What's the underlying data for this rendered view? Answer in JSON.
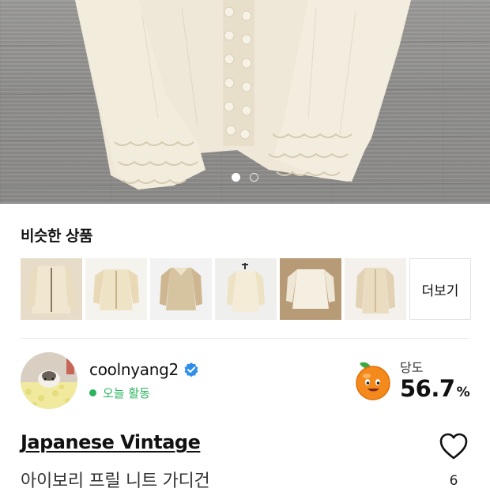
{
  "hero": {
    "slide_count": 2,
    "active_slide": 1
  },
  "similar": {
    "title": "비슷한 상품",
    "more_label": "더보기",
    "items": [
      {
        "icon": "cardigan-thumbnail"
      },
      {
        "icon": "cardigan-thumbnail"
      },
      {
        "icon": "blouse-thumbnail"
      },
      {
        "icon": "blouse-thumbnail"
      },
      {
        "icon": "lace-jacket-thumbnail"
      },
      {
        "icon": "blouse-thumbnail"
      }
    ]
  },
  "seller": {
    "username": "coolnyang2",
    "verified_icon": "verified-check-icon",
    "activity": "오늘 활동",
    "activity_color": "#2bb45e"
  },
  "sweetness": {
    "label": "당도",
    "value": "56.7",
    "unit": "%",
    "icon": "orange-mascot-icon"
  },
  "product": {
    "brand": "Japanese Vintage",
    "name": "아이보리 프릴 니트 가디건",
    "like_count": "6",
    "heart_icon": "heart-outline-icon"
  }
}
